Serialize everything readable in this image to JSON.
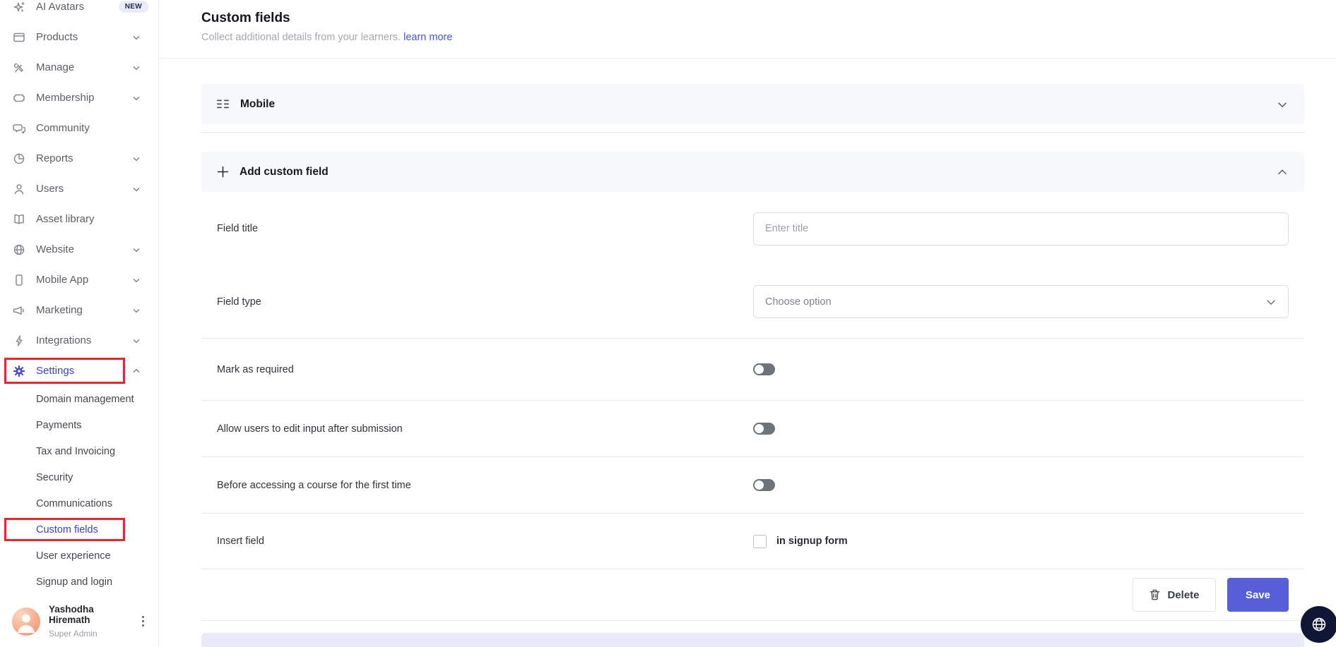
{
  "sidebar": {
    "items": [
      {
        "label": "AI Avatars",
        "icon": "sparkle-icon",
        "badge": "NEW"
      },
      {
        "label": "Products",
        "icon": "box-icon",
        "chevron": "down"
      },
      {
        "label": "Manage",
        "icon": "tools-icon",
        "chevron": "down"
      },
      {
        "label": "Membership",
        "icon": "ticket-icon",
        "chevron": "down"
      },
      {
        "label": "Community",
        "icon": "chat-icon"
      },
      {
        "label": "Reports",
        "icon": "pie-chart-icon",
        "chevron": "down"
      },
      {
        "label": "Users",
        "icon": "user-icon",
        "chevron": "down"
      },
      {
        "label": "Asset library",
        "icon": "book-icon"
      },
      {
        "label": "Website",
        "icon": "globe-icon",
        "chevron": "down"
      },
      {
        "label": "Mobile App",
        "icon": "phone-icon",
        "chevron": "down"
      },
      {
        "label": "Marketing",
        "icon": "megaphone-icon",
        "chevron": "down"
      },
      {
        "label": "Integrations",
        "icon": "lightning-icon",
        "chevron": "down"
      },
      {
        "label": "Settings",
        "icon": "gear-icon",
        "chevron": "up",
        "active": true,
        "annotated": true
      }
    ],
    "settings_subitems": [
      {
        "label": "Domain management"
      },
      {
        "label": "Payments"
      },
      {
        "label": "Tax and Invoicing"
      },
      {
        "label": "Security"
      },
      {
        "label": "Communications"
      },
      {
        "label": "Custom fields",
        "active": true,
        "annotated": true
      },
      {
        "label": "User experience"
      },
      {
        "label": "Signup and login"
      }
    ],
    "user": {
      "name": "Yashodha Hiremath",
      "role": "Super Admin"
    }
  },
  "header": {
    "title": "Custom fields",
    "subtitle": "Collect additional details from your learners.",
    "link_label": "learn more"
  },
  "sections": {
    "mobile": {
      "label": "Mobile",
      "state": "collapsed"
    },
    "add_custom_field": {
      "label": "Add custom field",
      "state": "expanded"
    }
  },
  "form": {
    "field_title": {
      "label": "Field title",
      "value": "",
      "placeholder": "Enter title"
    },
    "field_type": {
      "label": "Field type",
      "value": "Choose option"
    },
    "toggles": [
      {
        "label": "Mark as required",
        "on": false
      },
      {
        "label": "Allow users to edit input after submission",
        "on": false
      },
      {
        "label": "Before accessing a course for the first time",
        "on": false
      }
    ],
    "insert_field": {
      "label": "Insert field",
      "checkbox_label": "in signup form",
      "checked": false
    },
    "buttons": {
      "delete": "Delete",
      "save": "Save"
    }
  },
  "colors": {
    "accent_indigo": "#575fd8",
    "active_link": "#3c43c6",
    "annotation_red": "#e8262c",
    "section_bg": "#f7f8fa",
    "divider": "#e5e7ea",
    "lavender_strip": "#e9ebf9",
    "fab_bg": "#101734"
  }
}
